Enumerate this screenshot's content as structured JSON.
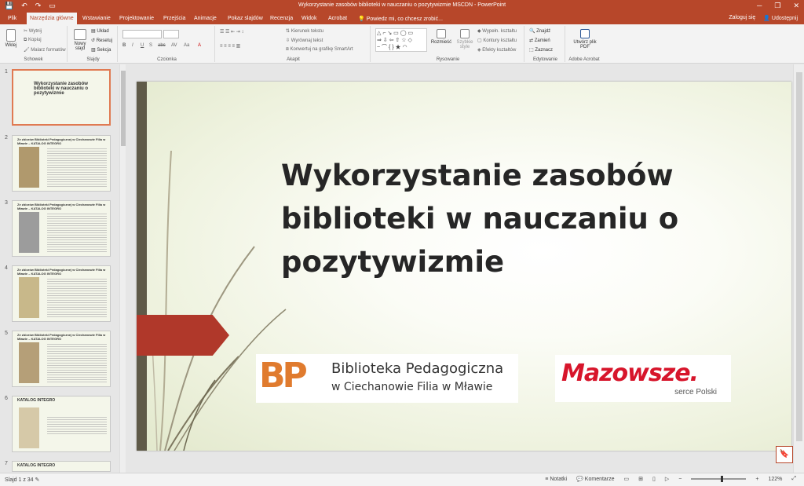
{
  "app": {
    "title": "Wykorzystanie zasobów biblioteki w nauczaniu o pozytywizmie MSCDN - PowerPoint",
    "qat": [
      "💾",
      "↶",
      "↷",
      "▭"
    ],
    "window_controls": [
      "─",
      "❐",
      "✕"
    ]
  },
  "tabs": [
    "Plik",
    "Narzędzia główne",
    "Wstawianie",
    "Projektowanie",
    "Przejścia",
    "Animacje",
    "Pokaz slajdów",
    "Recenzja",
    "Widok",
    "Acrobat"
  ],
  "active_tab": "Narzędzia główne",
  "tell_me": "Powiedz mi, co chcesz zrobić...",
  "account": {
    "signin": "Zaloguj się",
    "share": "Udostępnij"
  },
  "ribbon": {
    "clipboard": {
      "paste": "Wklej",
      "cut": "Wytnij",
      "copy": "Kopiuj",
      "format_painter": "Malarz formatów",
      "label": "Schowek"
    },
    "slides": {
      "new_slide": "Nowy slajd",
      "layout": "Układ",
      "reset": "Resetuj",
      "section": "Sekcja",
      "label": "Slajdy"
    },
    "font": {
      "label": "Czcionka",
      "buttons": [
        "B",
        "I",
        "U",
        "S",
        "abc",
        "AV",
        "Aa",
        "A"
      ]
    },
    "paragraph": {
      "text_direction": "Kierunek tekstu",
      "align_text": "Wyrównaj tekst",
      "smartart": "Konwertuj na grafikę SmartArt",
      "label": "Akapit"
    },
    "drawing": {
      "arrange": "Rozmieść",
      "quick_styles": "Szybkie style",
      "shape_fill": "Wypełn. kształtu",
      "shape_outline": "Kontury kształtu",
      "shape_effects": "Efekty kształtów",
      "label": "Rysowanie"
    },
    "editing": {
      "find": "Znajdź",
      "replace": "Zamień",
      "select": "Zaznacz",
      "label": "Edytowanie"
    },
    "acrobat": {
      "create_pdf": "Utwórz plik PDF",
      "label": "Adobe Acrobat"
    }
  },
  "thumbnails": [
    {
      "num": "1",
      "title": "Wykorzystanie zasobów biblioteki w nauczaniu o pozytywizmie"
    },
    {
      "num": "2",
      "title": "Ze zbiorów Biblioteki Pedagogicznej w Ciechanowie Filia w Mławie – KATALOG INTEGRO"
    },
    {
      "num": "3",
      "title": "Ze zbiorów Biblioteki Pedagogicznej w Ciechanowie Filia w Mławie – KATALOG INTEGRO"
    },
    {
      "num": "4",
      "title": "Ze zbiorów Biblioteki Pedagogicznej w Ciechanowie Filia w Mławie – KATALOG INTEGRO"
    },
    {
      "num": "5",
      "title": "Ze zbiorów Biblioteki Pedagogicznej w Ciechanowie Filia w Mławie – KATALOG INTEGRO"
    },
    {
      "num": "6",
      "title": "KATALOG INTEGRO"
    },
    {
      "num": "7",
      "title": "KATALOG INTEGRO"
    }
  ],
  "slide": {
    "title": "Wykorzystanie zasobów biblioteki w nauczaniu o pozytywizmie",
    "logo_bp_mark": "BP",
    "logo_bp_line1": "Biblioteka Pedagogiczna",
    "logo_bp_line2": "w Ciechanowie Filia w Mławie",
    "logo_maz_word": "Mazowsze.",
    "logo_maz_sub": "serce Polski"
  },
  "status": {
    "slide_info": "Slajd 1 z 34",
    "notes": "Notatki",
    "comments": "Komentarze",
    "zoom": "122%"
  },
  "colors": {
    "accent": "#b7472a",
    "slide_band": "#b0382a"
  }
}
